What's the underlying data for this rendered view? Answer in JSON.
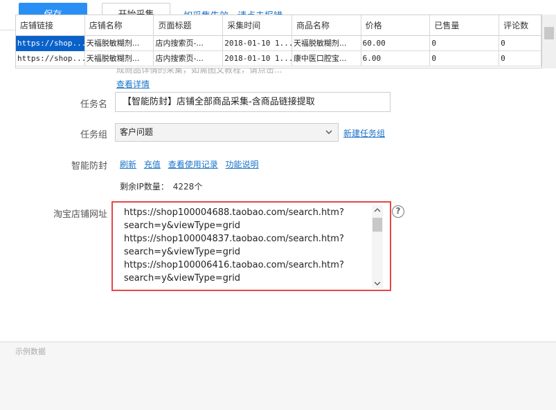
{
  "toolbar": {
    "save_label": "保存",
    "start_label": "开始采集",
    "report_link": "如采集失效，请点击报错"
  },
  "description": {
    "text": "此模板采集淘宝店铺全部商品信息并含商品链接的提取。采完后，可将商品链接复制到「【智能防封】商品详情页采集」模板的「详情页面网址」输入框内。可完成商品详情的采集，如需图文教程，请点击...",
    "view_detail": "查看详情"
  },
  "form": {
    "task_name_label": "任务名",
    "task_name_value": "【智能防封】店铺全部商品采集-含商品链接提取",
    "task_group_label": "任务组",
    "task_group_value": "客户问题",
    "new_group_link": "新建任务组",
    "anti_block_label": "智能防封",
    "anti_block_links": [
      "刷新",
      "充值",
      "查看使用记录",
      "功能说明"
    ],
    "ip_label": "剩余IP数量：",
    "ip_value": "4228个",
    "shop_url_label": "淘宝店铺网址",
    "shop_url_value": "https://shop100004688.taobao.com/search.htm?\nsearch=y&viewType=grid\nhttps://shop100004837.taobao.com/search.htm?\nsearch=y&viewType=grid\nhttps://shop100006416.taobao.com/search.htm?\nsearch=y&viewType=grid",
    "help_glyph": "?"
  },
  "sample": {
    "title": "示例数据",
    "columns": [
      "店铺链接",
      "店铺名称",
      "页面标题",
      "采集时间",
      "商品名称",
      "价格",
      "已售量",
      "评论数"
    ],
    "rows": [
      [
        "https://shop...",
        "天福脱敏糊剂...",
        "店内搜索页-...",
        "2018-01-10 1...",
        "天福脱敏糊剂...",
        "60.00",
        "0",
        "0"
      ],
      [
        "https://shop...",
        "天福脱敏糊剂...",
        "店内搜索页-...",
        "2018-01-10 1...",
        "康中医口腔宝...",
        "6.00",
        "0",
        "0"
      ]
    ]
  },
  "colors": {
    "primary": "#2a8ff5",
    "link": "#1a73c8",
    "highlight_border": "#e54646",
    "selection": "#0a62c9"
  }
}
